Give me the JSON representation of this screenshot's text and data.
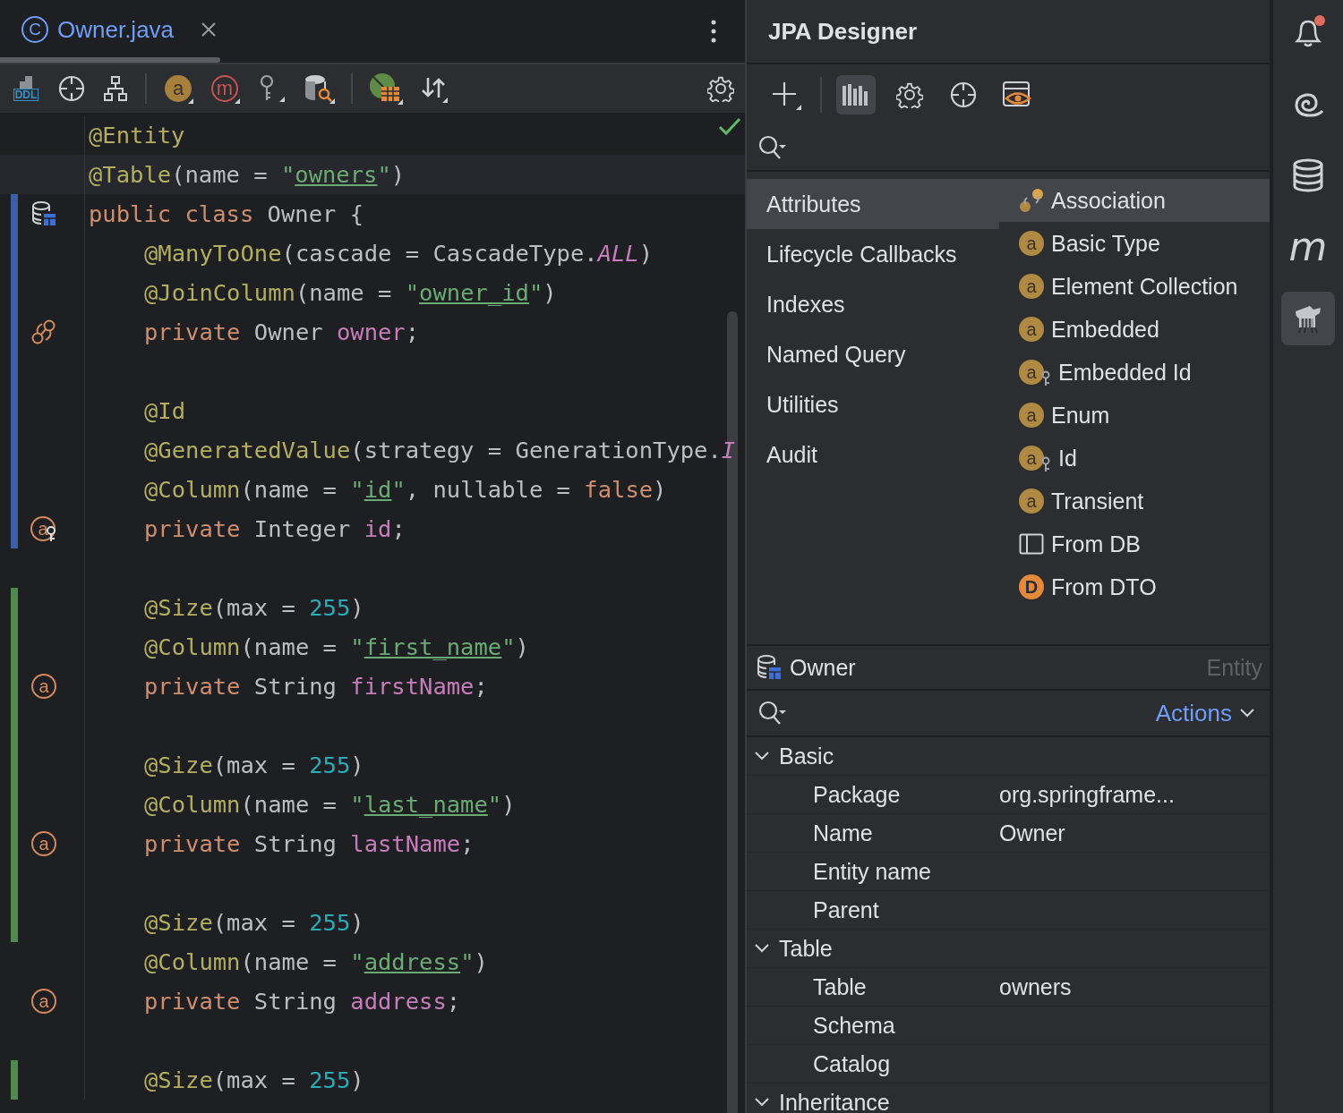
{
  "editor": {
    "tab": {
      "icon_text": "C",
      "title": "Owner.java",
      "selected": true
    },
    "toolbar": [
      {
        "kind": "ddl",
        "text": "DDL"
      },
      {
        "kind": "target"
      },
      {
        "kind": "hierarchy"
      },
      {
        "kind": "separator"
      },
      {
        "kind": "attr-badge",
        "text": "a"
      },
      {
        "kind": "method-badge",
        "text": "m"
      },
      {
        "kind": "key"
      },
      {
        "kind": "db-search"
      },
      {
        "kind": "separator"
      },
      {
        "kind": "jpa-table"
      },
      {
        "kind": "sort"
      }
    ],
    "lines": [
      {
        "indented": false,
        "current": false,
        "tokens": [
          {
            "kind": "ann",
            "t": "@Entity"
          }
        ]
      },
      {
        "indented": false,
        "current": true,
        "tokens": [
          {
            "kind": "ann",
            "t": "@Table"
          },
          {
            "kind": "plain",
            "t": "(name = "
          },
          {
            "kind": "str",
            "t": "\""
          },
          {
            "kind": "link",
            "t": "owners"
          },
          {
            "kind": "str",
            "t": "\""
          },
          {
            "kind": "plain",
            "t": ")"
          }
        ]
      },
      {
        "indented": false,
        "current": false,
        "change": {
          "kind": "modified"
        },
        "gutter": {
          "kind": "entity"
        },
        "tokens": [
          {
            "kind": "kw",
            "t": "public class "
          },
          {
            "kind": "plain",
            "t": "Owner {"
          }
        ]
      },
      {
        "indented": true,
        "current": false,
        "change": {
          "kind": "modified"
        },
        "tokens": [
          {
            "kind": "ann",
            "t": "@ManyToOne"
          },
          {
            "kind": "plain",
            "t": "(cascade = CascadeType."
          },
          {
            "kind": "const",
            "t": "ALL"
          },
          {
            "kind": "plain",
            "t": ")"
          }
        ]
      },
      {
        "indented": true,
        "current": false,
        "change": {
          "kind": "modified"
        },
        "tokens": [
          {
            "kind": "ann",
            "t": "@JoinColumn"
          },
          {
            "kind": "plain",
            "t": "(name = "
          },
          {
            "kind": "str",
            "t": "\""
          },
          {
            "kind": "link",
            "t": "owner_id"
          },
          {
            "kind": "str",
            "t": "\""
          },
          {
            "kind": "plain",
            "t": ")"
          }
        ]
      },
      {
        "indented": true,
        "current": false,
        "change": {
          "kind": "modified"
        },
        "gutter": {
          "kind": "association"
        },
        "tokens": [
          {
            "kind": "kw",
            "t": "private "
          },
          {
            "kind": "plain",
            "t": "Owner "
          },
          {
            "kind": "field",
            "t": "owner"
          },
          {
            "kind": "plain",
            "t": ";"
          }
        ]
      },
      {
        "current": false,
        "change": {
          "kind": "modified"
        }
      },
      {
        "indented": true,
        "current": false,
        "change": {
          "kind": "modified"
        },
        "tokens": [
          {
            "kind": "ann",
            "t": "@Id"
          }
        ]
      },
      {
        "indented": true,
        "current": false,
        "change": {
          "kind": "modified"
        },
        "tokens": [
          {
            "kind": "ann",
            "t": "@GeneratedValue"
          },
          {
            "kind": "plain",
            "t": "(strategy = GenerationType."
          },
          {
            "kind": "const",
            "t": "I"
          }
        ]
      },
      {
        "indented": true,
        "current": false,
        "change": {
          "kind": "modified"
        },
        "tokens": [
          {
            "kind": "ann",
            "t": "@Column"
          },
          {
            "kind": "plain",
            "t": "(name = "
          },
          {
            "kind": "str",
            "t": "\""
          },
          {
            "kind": "link",
            "t": "id"
          },
          {
            "kind": "str",
            "t": "\""
          },
          {
            "kind": "plain",
            "t": ", nullable = "
          },
          {
            "kind": "kw",
            "t": "false"
          },
          {
            "kind": "plain",
            "t": ")"
          }
        ]
      },
      {
        "indented": true,
        "current": false,
        "change": {
          "kind": "modified"
        },
        "gutter": {
          "kind": "id",
          "text": "a"
        },
        "tokens": [
          {
            "kind": "kw",
            "t": "private "
          },
          {
            "kind": "plain",
            "t": "Integer "
          },
          {
            "kind": "field",
            "t": "id"
          },
          {
            "kind": "plain",
            "t": ";"
          }
        ]
      },
      {
        "current": false
      },
      {
        "indented": true,
        "current": false,
        "change": {
          "kind": "added"
        },
        "tokens": [
          {
            "kind": "ann",
            "t": "@Size"
          },
          {
            "kind": "plain",
            "t": "(max = "
          },
          {
            "kind": "num",
            "t": "255"
          },
          {
            "kind": "plain",
            "t": ")"
          }
        ]
      },
      {
        "indented": true,
        "current": false,
        "change": {
          "kind": "added"
        },
        "tokens": [
          {
            "kind": "ann",
            "t": "@Column"
          },
          {
            "kind": "plain",
            "t": "(name = "
          },
          {
            "kind": "str",
            "t": "\""
          },
          {
            "kind": "link",
            "t": "first_name"
          },
          {
            "kind": "str",
            "t": "\""
          },
          {
            "kind": "plain",
            "t": ")"
          }
        ]
      },
      {
        "indented": true,
        "current": false,
        "change": {
          "kind": "added"
        },
        "gutter": {
          "kind": "attribute",
          "text": "a"
        },
        "tokens": [
          {
            "kind": "kw",
            "t": "private "
          },
          {
            "kind": "plain",
            "t": "String "
          },
          {
            "kind": "field",
            "t": "firstName"
          },
          {
            "kind": "plain",
            "t": ";"
          }
        ]
      },
      {
        "current": false,
        "change": {
          "kind": "added"
        }
      },
      {
        "indented": true,
        "current": false,
        "change": {
          "kind": "added"
        },
        "tokens": [
          {
            "kind": "ann",
            "t": "@Size"
          },
          {
            "kind": "plain",
            "t": "(max = "
          },
          {
            "kind": "num",
            "t": "255"
          },
          {
            "kind": "plain",
            "t": ")"
          }
        ]
      },
      {
        "indented": true,
        "current": false,
        "change": {
          "kind": "added"
        },
        "tokens": [
          {
            "kind": "ann",
            "t": "@Column"
          },
          {
            "kind": "plain",
            "t": "(name = "
          },
          {
            "kind": "str",
            "t": "\""
          },
          {
            "kind": "link",
            "t": "last_name"
          },
          {
            "kind": "str",
            "t": "\""
          },
          {
            "kind": "plain",
            "t": ")"
          }
        ]
      },
      {
        "indented": true,
        "current": false,
        "change": {
          "kind": "added"
        },
        "gutter": {
          "kind": "attribute",
          "text": "a"
        },
        "tokens": [
          {
            "kind": "kw",
            "t": "private "
          },
          {
            "kind": "plain",
            "t": "String "
          },
          {
            "kind": "field",
            "t": "lastName"
          },
          {
            "kind": "plain",
            "t": ";"
          }
        ]
      },
      {
        "current": false,
        "change": {
          "kind": "added"
        }
      },
      {
        "indented": true,
        "current": false,
        "change": {
          "kind": "added"
        },
        "tokens": [
          {
            "kind": "ann",
            "t": "@Size"
          },
          {
            "kind": "plain",
            "t": "(max = "
          },
          {
            "kind": "num",
            "t": "255"
          },
          {
            "kind": "plain",
            "t": ")"
          }
        ]
      },
      {
        "indented": true,
        "current": false,
        "tokens": [
          {
            "kind": "ann",
            "t": "@Column"
          },
          {
            "kind": "plain",
            "t": "(name = "
          },
          {
            "kind": "str",
            "t": "\""
          },
          {
            "kind": "link",
            "t": "address"
          },
          {
            "kind": "str",
            "t": "\""
          },
          {
            "kind": "plain",
            "t": ")"
          }
        ]
      },
      {
        "indented": true,
        "current": false,
        "gutter": {
          "kind": "attribute",
          "text": "a"
        },
        "tokens": [
          {
            "kind": "kw",
            "t": "private "
          },
          {
            "kind": "plain",
            "t": "String "
          },
          {
            "kind": "field",
            "t": "address"
          },
          {
            "kind": "plain",
            "t": ";"
          }
        ]
      },
      {
        "current": false
      },
      {
        "indented": true,
        "current": false,
        "change": {
          "kind": "added"
        },
        "tokens": [
          {
            "kind": "ann",
            "t": "@Size"
          },
          {
            "kind": "plain",
            "t": "(max = "
          },
          {
            "kind": "num",
            "t": "255"
          },
          {
            "kind": "plain",
            "t": ")"
          }
        ]
      }
    ]
  },
  "designer": {
    "title": "JPA Designer",
    "toolbar": [
      {
        "kind": "add",
        "selected": false
      },
      {
        "kind": "separator"
      },
      {
        "kind": "palette",
        "selected": true
      },
      {
        "kind": "settings",
        "selected": false
      },
      {
        "kind": "target",
        "selected": false
      },
      {
        "kind": "preview",
        "selected": false
      }
    ],
    "categories": [
      {
        "label": "Attributes",
        "selected": true
      },
      {
        "label": "Lifecycle Callbacks",
        "selected": false
      },
      {
        "label": "Indexes",
        "selected": false
      },
      {
        "label": "Named Query",
        "selected": false
      },
      {
        "label": "Utilities",
        "selected": false
      },
      {
        "label": "Audit",
        "selected": false
      }
    ],
    "items": [
      {
        "label": "Association",
        "kind": "association",
        "selected": true
      },
      {
        "label": "Basic Type",
        "kind": "attribute",
        "icon_text": "a",
        "selected": false
      },
      {
        "label": "Element Collection",
        "kind": "attribute",
        "icon_text": "a",
        "selected": false
      },
      {
        "label": "Embedded",
        "kind": "attribute",
        "icon_text": "a",
        "selected": false
      },
      {
        "label": "Embedded Id",
        "kind": "attribute-key",
        "icon_text": "a",
        "selected": false
      },
      {
        "label": "Enum",
        "kind": "attribute",
        "icon_text": "a",
        "selected": false
      },
      {
        "label": "Id",
        "kind": "attribute-key",
        "icon_text": "a",
        "selected": false
      },
      {
        "label": "Transient",
        "kind": "attribute",
        "icon_text": "a",
        "selected": false
      },
      {
        "label": "From DB",
        "kind": "table",
        "selected": false
      },
      {
        "label": "From DTO",
        "kind": "dto",
        "icon_text": "D",
        "selected": false
      }
    ],
    "entity": {
      "name": "Owner",
      "type": "Entity"
    },
    "actions": "Actions",
    "properties": [
      {
        "label": "Basic",
        "expanded": true,
        "children": [
          {
            "label": "Package",
            "value": "org.springframe..."
          },
          {
            "label": "Name",
            "value": "Owner"
          },
          {
            "label": "Entity name"
          },
          {
            "label": "Parent"
          }
        ]
      },
      {
        "label": "Table",
        "expanded": true,
        "children": [
          {
            "label": "Table",
            "value": "owners"
          },
          {
            "label": "Schema"
          },
          {
            "label": "Catalog"
          }
        ]
      },
      {
        "label": "Inheritance",
        "expanded": true
      }
    ]
  },
  "rail": [
    {
      "kind": "notifications",
      "badge": true,
      "selected": false
    },
    {
      "kind": "spiral",
      "selected": false
    },
    {
      "kind": "database",
      "selected": false
    },
    {
      "kind": "letter",
      "text": "m",
      "selected": false
    },
    {
      "kind": "mascot",
      "selected": true
    }
  ]
}
